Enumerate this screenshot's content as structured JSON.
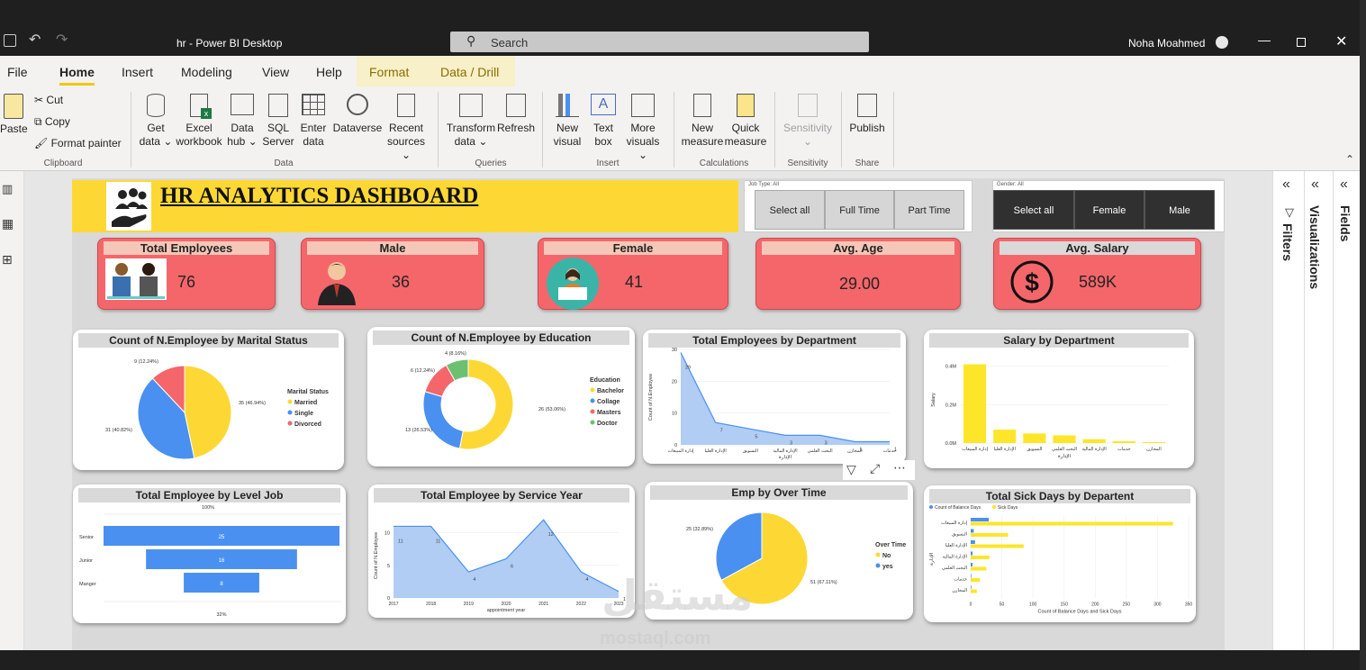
{
  "window": {
    "title": "hr - Power BI Desktop",
    "search_label": "Search",
    "user": "Noha Moahmed"
  },
  "menu": {
    "file": "File",
    "home": "Home",
    "insert": "Insert",
    "modeling": "Modeling",
    "view": "View",
    "help": "Help",
    "format": "Format",
    "data_drill": "Data / Drill"
  },
  "ribbon": {
    "paste": "Paste",
    "cut": "Cut",
    "copy": "Copy",
    "format_painter": "Format painter",
    "clipboard": "Clipboard",
    "get_data": [
      "Get",
      "data"
    ],
    "excel": [
      "Excel",
      "workbook"
    ],
    "data_hub": [
      "Data",
      "hub"
    ],
    "sql": [
      "SQL",
      "Server"
    ],
    "enter_data": [
      "Enter",
      "data"
    ],
    "dataverse": "Dataverse",
    "recent": [
      "Recent",
      "sources"
    ],
    "data_group": "Data",
    "transform": [
      "Transform",
      "data"
    ],
    "refresh": "Refresh",
    "queries": "Queries",
    "new_visual": [
      "New",
      "visual"
    ],
    "text_box": [
      "Text",
      "box"
    ],
    "more_visuals": [
      "More",
      "visuals"
    ],
    "insert_group": "Insert",
    "new_measure": [
      "New",
      "measure"
    ],
    "quick_measure": [
      "Quick",
      "measure"
    ],
    "calculations": "Calculations",
    "sensitivity": "Sensitivity",
    "sensitivity_group": "Sensitivity",
    "publish": "Publish",
    "share": "Share"
  },
  "dashboard": {
    "title": "HR ANALYTICS DASHBOARD",
    "job_slicer": {
      "header": "Job Type: All",
      "options": [
        "Select all",
        "Full Time",
        "Part Time"
      ]
    },
    "gender_slicer": {
      "header": "Gender: All",
      "options": [
        "Select all",
        "Female",
        "Male"
      ]
    },
    "kpis": {
      "total": {
        "label": "Total Employees",
        "value": "76"
      },
      "male": {
        "label": "Male",
        "value": "36"
      },
      "female": {
        "label": "Female",
        "value": "41"
      },
      "age": {
        "label": "Avg. Age",
        "value": "29.00"
      },
      "salary": {
        "label": "Avg. Salary",
        "value": "589K"
      }
    }
  },
  "panes": {
    "filters": "Filters",
    "visualizations": "Visualizations",
    "fields": "Fields"
  },
  "watermark": {
    "arabic": "مستقل",
    "latin": "mostaql.com"
  },
  "colors": {
    "yellow": "#fdd835",
    "blue": "#4a90f0",
    "red": "#f4666a",
    "green": "#6cc070",
    "kpi_red": "#f5666a"
  },
  "chart_data": [
    {
      "id": "marital",
      "type": "pie",
      "title": "Count of N.Employee by Marital Status",
      "legend_title": "Marital Status",
      "labels": [
        "Married",
        "Single",
        "Divorced"
      ],
      "values": [
        35,
        31,
        9
      ],
      "data_labels": [
        "35 (46.94%)",
        "31 (40.82%)",
        "9 (12.24%)"
      ],
      "colors": [
        "#fdd835",
        "#4a90f0",
        "#f4666a"
      ]
    },
    {
      "id": "education",
      "type": "donut",
      "title": "Count of N.Employee by Education",
      "legend_title": "Education",
      "labels": [
        "Bachelor",
        "Collage",
        "Masters",
        "Doctor"
      ],
      "values": [
        26,
        13,
        6,
        4
      ],
      "data_labels": [
        "26 (53.06%)",
        "13 (26.53%)",
        "6 (12.24%)",
        "4 (8.16%)"
      ],
      "colors": [
        "#fdd835",
        "#4a90f0",
        "#f4666a",
        "#6cc070"
      ]
    },
    {
      "id": "dept",
      "type": "area",
      "title": "Total Employees by Department",
      "ylabel": "Count of N.Employee",
      "xlabel": "الإدارة",
      "categories": [
        "إدارة المبيعات",
        "الإدارة العليا",
        "التسويق",
        "الإدارة المالية",
        "البحث العلمي",
        "المخازن",
        "خدمات"
      ],
      "values": [
        29,
        7,
        5,
        3,
        3,
        1,
        1
      ],
      "data_labels": [
        "29",
        "7",
        "5",
        "3",
        "3",
        "1",
        "1"
      ],
      "yticks": [
        "0",
        "10",
        "20",
        "30"
      ],
      "ylim": [
        0,
        30
      ]
    },
    {
      "id": "salary_dept",
      "type": "bar",
      "title": "Salary by Department",
      "ylabel": "Salary",
      "xlabel": "الإدارة",
      "categories": [
        "إدارة المبيعات",
        "الإدارة العليا",
        "التسويق",
        "البحث العلمي",
        "الإدارة المالية",
        "خدمات",
        "المخازن"
      ],
      "values": [
        0.41,
        0.07,
        0.05,
        0.04,
        0.02,
        0.01,
        0.005
      ],
      "yticks": [
        "0.0M",
        "0.2M",
        "0.4M"
      ],
      "ylim": [
        0,
        0.45
      ]
    },
    {
      "id": "level",
      "type": "funnel",
      "title": "Total Employee by Level Job",
      "categories": [
        "Senior",
        "Junior",
        "Manger"
      ],
      "values": [
        25,
        16,
        8
      ],
      "data_labels": [
        "25",
        "16",
        "8"
      ],
      "top_label": "100%",
      "bottom_label": "32%"
    },
    {
      "id": "service",
      "type": "area",
      "title": "Total Employee by Service Year",
      "ylabel": "Count of N.Employee",
      "xlabel": "appointment year",
      "categories": [
        "2017",
        "2018",
        "2019",
        "2020",
        "2021",
        "2022",
        "2023"
      ],
      "values": [
        11,
        11,
        4,
        6,
        12,
        4,
        1
      ],
      "data_labels": [
        "11",
        "11",
        "4",
        "6",
        "12",
        "4",
        "1"
      ],
      "yticks": [
        "0",
        "5",
        "10"
      ],
      "ylim": [
        0,
        13
      ]
    },
    {
      "id": "overtime",
      "type": "pie",
      "title": "Emp by Over Time",
      "legend_title": "Over Time",
      "labels": [
        "No",
        "yes"
      ],
      "values": [
        51,
        25
      ],
      "data_labels": [
        "51 (67.11%)",
        "25 (32.89%)"
      ],
      "colors": [
        "#fdd835",
        "#4a90f0"
      ]
    },
    {
      "id": "sick",
      "type": "hbar",
      "title": "Total Sick Days by Departent",
      "xlabel": "Count of Balance Days and Sick Days",
      "ylabel": "الإدارة",
      "series_names": [
        "Count of Balance Days",
        "Sick Days"
      ],
      "categories": [
        "إدارة المبيعات",
        "التسويق",
        "الإدارة العليا",
        "الإدارة المالية",
        "البحث العلمي",
        "خدمات",
        "المخازن"
      ],
      "series": [
        {
          "name": "Count of Balance Days",
          "values": [
            29,
            5,
            7,
            3,
            3,
            1,
            1
          ]
        },
        {
          "name": "Sick Days",
          "values": [
            325,
            60,
            85,
            30,
            25,
            15,
            10
          ]
        }
      ],
      "xticks": [
        "0",
        "50",
        "100",
        "150",
        "200",
        "250",
        "300",
        "350"
      ],
      "xlim": [
        0,
        350
      ]
    }
  ]
}
